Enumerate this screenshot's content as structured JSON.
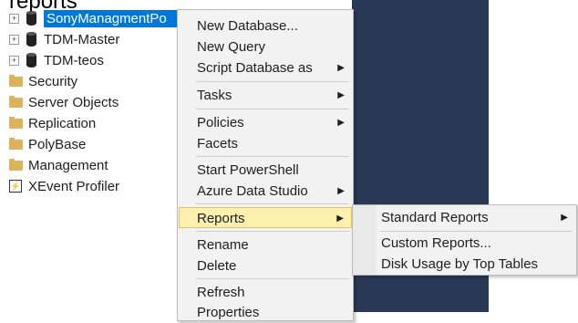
{
  "top_cut_text": "reports",
  "tree": {
    "items": [
      {
        "label": "SonyManagmentPo",
        "icon": "database-icon",
        "expander": "+",
        "selected": true
      },
      {
        "label": "TDM-Master",
        "icon": "database-icon",
        "expander": "+"
      },
      {
        "label": "TDM-teos",
        "icon": "database-icon",
        "expander": "+"
      },
      {
        "label": "Security",
        "icon": "folder-icon"
      },
      {
        "label": "Server Objects",
        "icon": "folder-icon"
      },
      {
        "label": "Replication",
        "icon": "folder-icon"
      },
      {
        "label": "PolyBase",
        "icon": "folder-icon"
      },
      {
        "label": "Management",
        "icon": "folder-icon"
      },
      {
        "label": "XEvent Profiler",
        "icon": "xevent-icon"
      }
    ]
  },
  "context_menu": {
    "items": [
      {
        "label": "New Database..."
      },
      {
        "label": "New Query"
      },
      {
        "label": "Script Database as",
        "submenu_arrow": "▶"
      },
      {
        "label": "Tasks",
        "submenu_arrow": "▶"
      },
      {
        "label": "Policies",
        "submenu_arrow": "▶"
      },
      {
        "label": "Facets"
      },
      {
        "label": "Start PowerShell"
      },
      {
        "label": "Azure Data Studio",
        "submenu_arrow": "▶"
      },
      {
        "label": "Reports",
        "submenu_arrow": "▶",
        "highlighted": true
      },
      {
        "label": "Rename"
      },
      {
        "label": "Delete"
      },
      {
        "label": "Refresh"
      },
      {
        "label": "Properties"
      }
    ]
  },
  "reports_submenu": {
    "items": [
      {
        "label": "Standard Reports",
        "submenu_arrow": "▶"
      },
      {
        "label": "Custom Reports..."
      },
      {
        "label": "Disk Usage by Top Tables"
      }
    ]
  },
  "colors": {
    "selection": "#0078d7",
    "menu_background": "#f2f2f2",
    "menu_highlight": "#fff0b0",
    "dark_panel": "#293955",
    "folder": "#dcb35c"
  }
}
